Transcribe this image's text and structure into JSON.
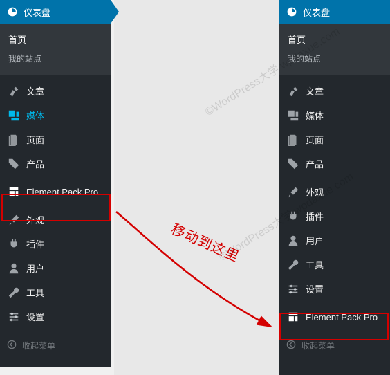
{
  "header": {
    "title": "仪表盘"
  },
  "submenu": {
    "home": "首页",
    "mysite": "我的站点"
  },
  "menu": {
    "posts": "文章",
    "media": "媒体",
    "pages": "页面",
    "products": "产品",
    "element_pack": "Element Pack Pro",
    "appearance": "外观",
    "plugins": "插件",
    "users": "用户",
    "tools": "工具",
    "settings": "设置"
  },
  "collapse": "收起菜单",
  "annotation": "移动到这里",
  "watermark": "©WordPress大学\nwpdaxue.com",
  "colors": {
    "accent": "#0073aa",
    "highlight": "#d40000",
    "active": "#00b9eb"
  }
}
